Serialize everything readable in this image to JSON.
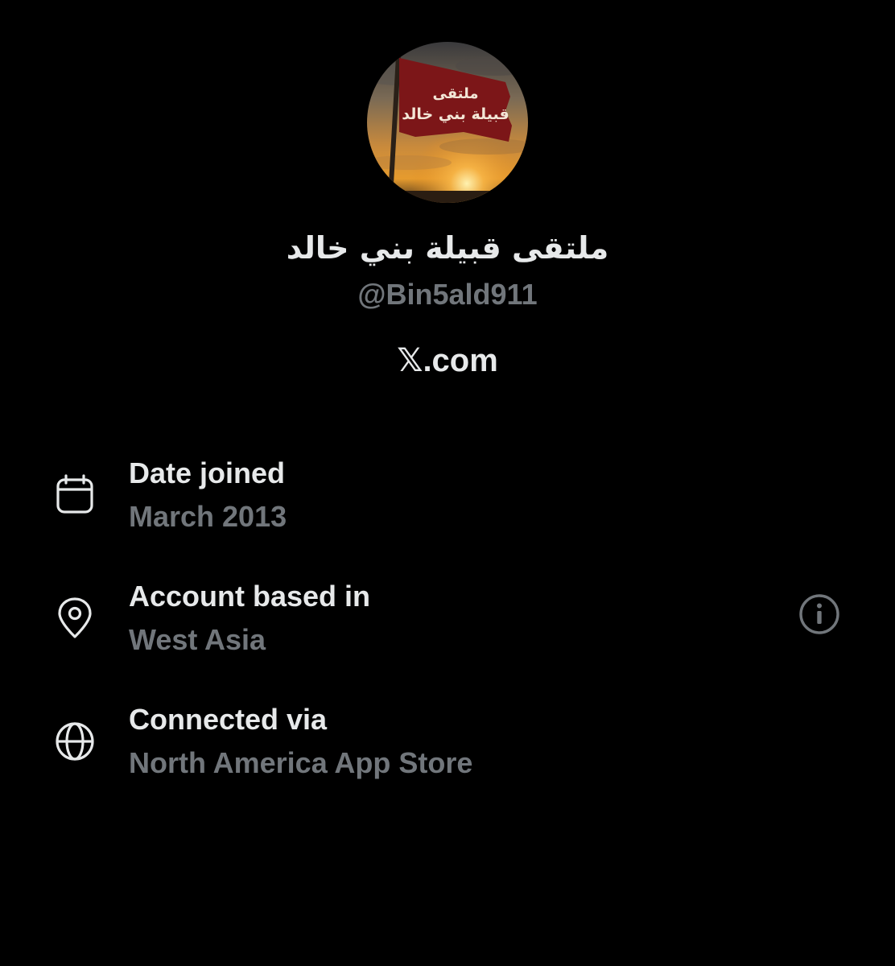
{
  "profile": {
    "display_name": "ملتقى قبيلة بني خالد",
    "handle": "@Bin5ald911",
    "site": {
      "x_glyph": "𝕏",
      "suffix": ".com"
    },
    "avatar": {
      "flag_line_1": "ملتقى",
      "flag_line_2": "قبيلة بني خالد",
      "flag_color": "#8e1a1c"
    }
  },
  "details": [
    {
      "icon": "calendar-icon",
      "label": "Date joined",
      "value": "March 2013"
    },
    {
      "icon": "location-pin-icon",
      "label": "Account based in",
      "value": "West Asia",
      "action_icon": "info-icon"
    },
    {
      "icon": "globe-icon",
      "label": "Connected via",
      "value": "North America App Store"
    }
  ],
  "colors": {
    "background": "#000000",
    "primary_text": "#e7e9ea",
    "secondary_text": "#71767b"
  }
}
